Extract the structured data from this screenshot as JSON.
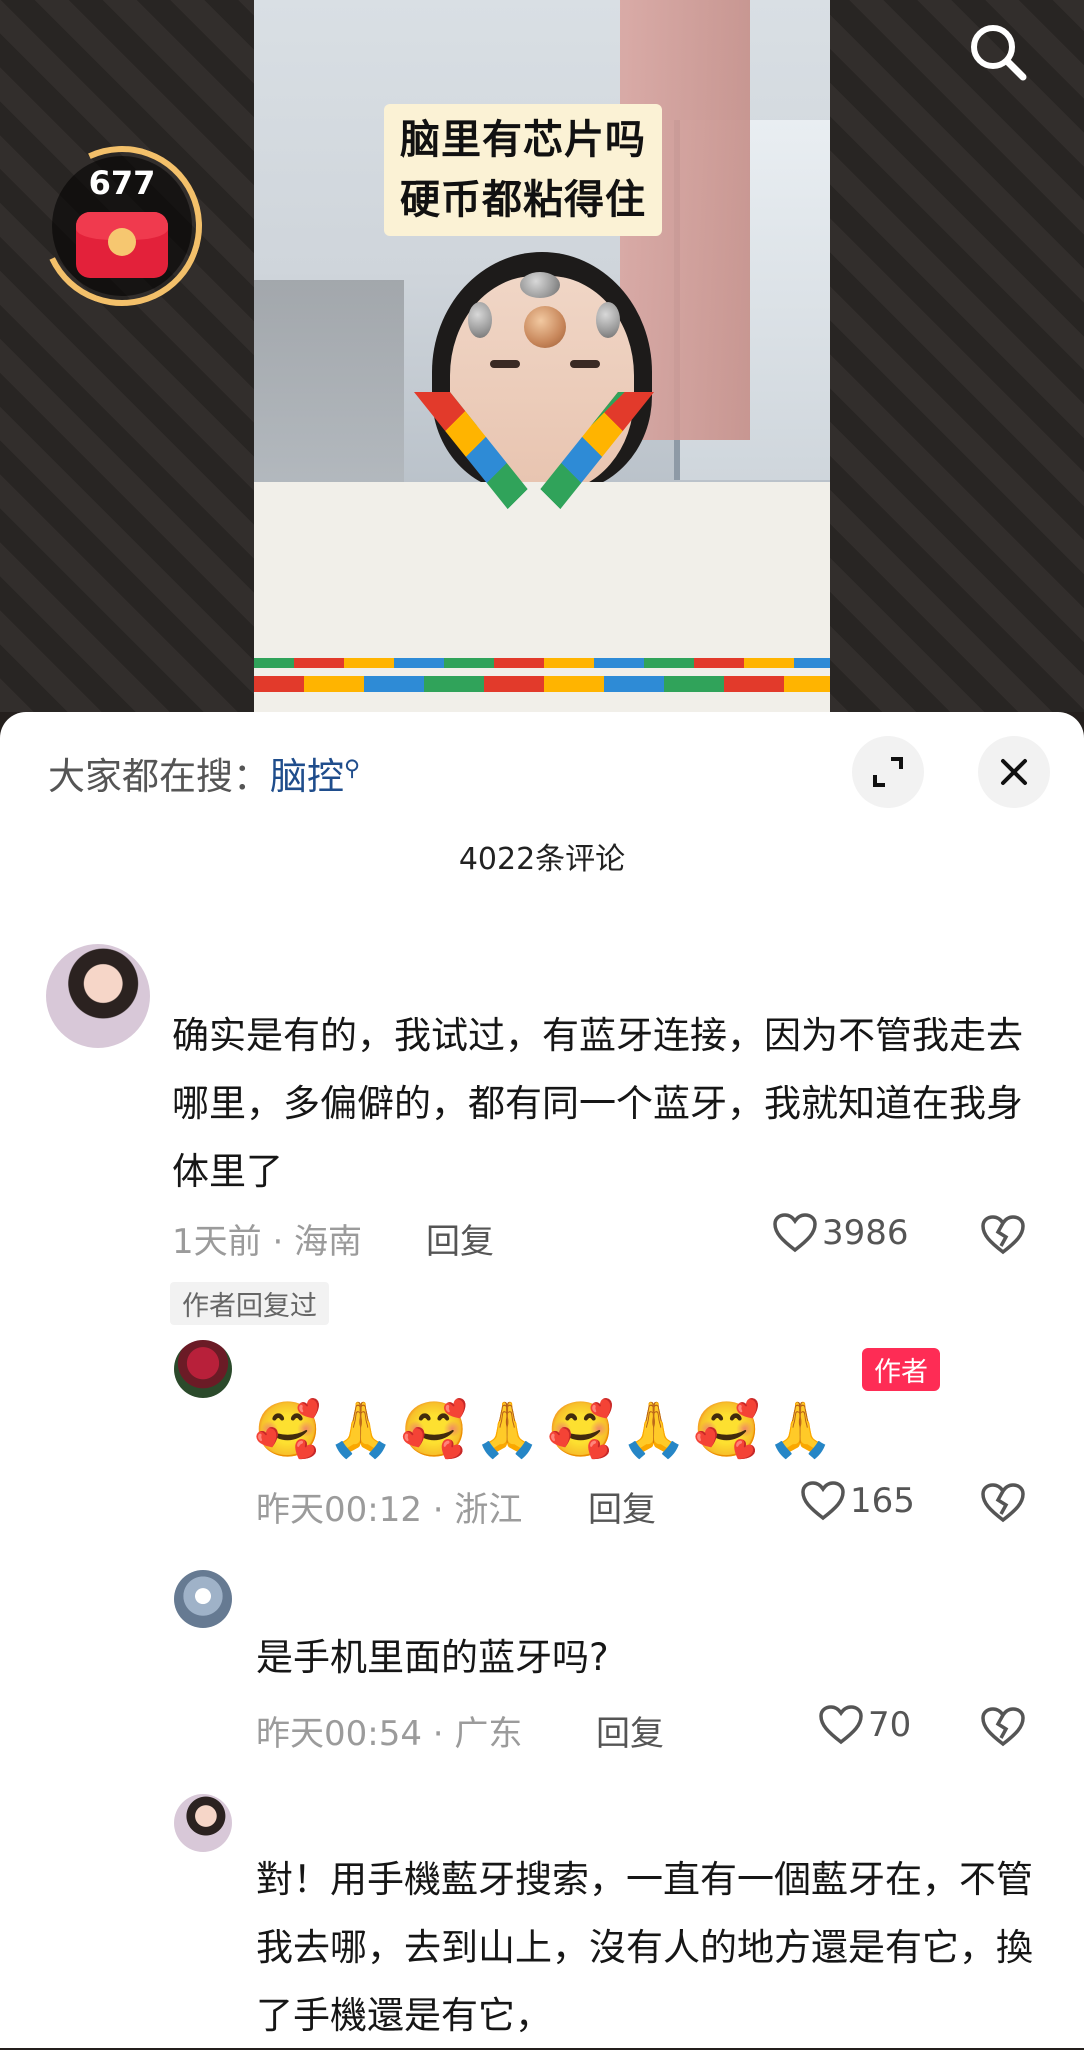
{
  "video": {
    "caption_lines": [
      "脑里有芯片吗",
      "硬币都粘得住"
    ],
    "red_packet_count": "677",
    "search_icon": "search-icon",
    "red_packet_icon": "red-envelope-icon"
  },
  "sheet": {
    "hot_search_prefix": "大家都在搜：",
    "hot_search_keyword": "脑控",
    "comment_count": "4022条评论",
    "expand_icon": "expand-icon",
    "close_icon": "close-icon"
  },
  "comments": [
    {
      "text": "确实是有的，我试过，有蓝牙连接，因为不管我走去哪里，多偏僻的，都有同一个蓝牙，我就知道在我身体里了",
      "time_location": "1天前 · 海南",
      "reply_label": "回复",
      "likes": "3986",
      "author_replied_tag": "作者回复过"
    },
    {
      "text": "🥰🙏🥰🙏🥰🙏🥰🙏",
      "author_tag": "作者",
      "time_location": "昨天00:12 · 浙江",
      "reply_label": "回复",
      "likes": "165"
    },
    {
      "text": "是手机里面的蓝牙吗?",
      "time_location": "昨天00:54 · 广东",
      "reply_label": "回复",
      "likes": "70"
    },
    {
      "text": "對！用手機藍牙搜索，一直有一個藍牙在，不管我去哪，去到山上，沒有人的地方還是有它，換了手機還是有它，"
    }
  ]
}
